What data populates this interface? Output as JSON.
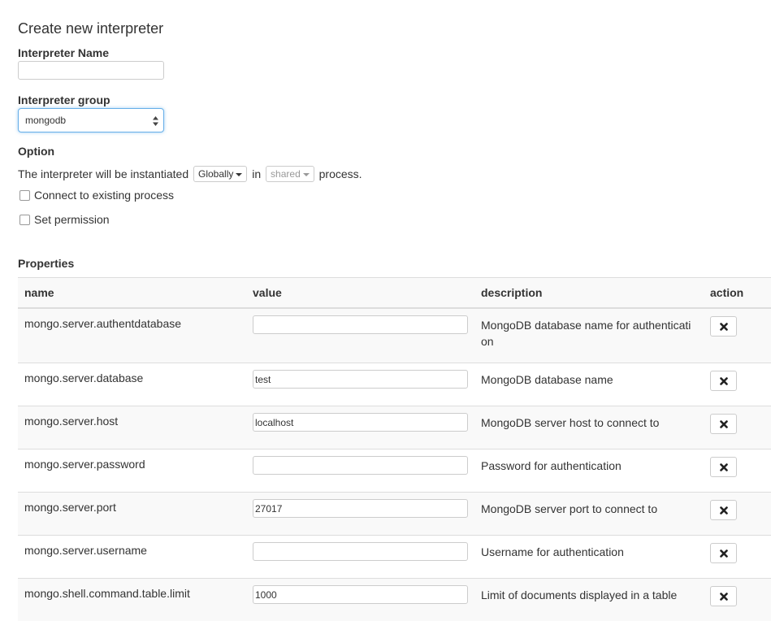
{
  "page": {
    "title": "Create new interpreter",
    "name_label": "Interpreter Name",
    "name_value": "",
    "group_label": "Interpreter group",
    "group_value": "mongodb",
    "option_label": "Option",
    "instantiate_prefix": "The interpreter will be instantiated",
    "scope_value": "Globally",
    "in_word": "in",
    "process_value": "shared",
    "instantiate_suffix": "process.",
    "connect_existing_label": "Connect to existing process",
    "set_permission_label": "Set permission",
    "properties_label": "Properties"
  },
  "table": {
    "headers": {
      "name": "name",
      "value": "value",
      "description": "description",
      "action": "action"
    },
    "rows": [
      {
        "name": "mongo.server.authentdatabase",
        "value": "",
        "description": "MongoDB database name for authentication"
      },
      {
        "name": "mongo.server.database",
        "value": "test",
        "description": "MongoDB database name"
      },
      {
        "name": "mongo.server.host",
        "value": "localhost",
        "description": "MongoDB server host to connect to"
      },
      {
        "name": "mongo.server.password",
        "value": "",
        "description": "Password for authentication"
      },
      {
        "name": "mongo.server.port",
        "value": "27017",
        "description": "MongoDB server port to connect to"
      },
      {
        "name": "mongo.server.username",
        "value": "",
        "description": "Username for authentication"
      },
      {
        "name": "mongo.shell.command.table.limit",
        "value": "1000",
        "description": "Limit of documents displayed in a table"
      }
    ]
  },
  "icons": {
    "delete": "close-icon",
    "select_arrows": "updown-arrows-icon",
    "dropdown_caret": "caret-down-icon"
  },
  "colors": {
    "focus_border": "#66afe9",
    "table_stripe": "#f9f9f9",
    "border": "#dddddd"
  }
}
